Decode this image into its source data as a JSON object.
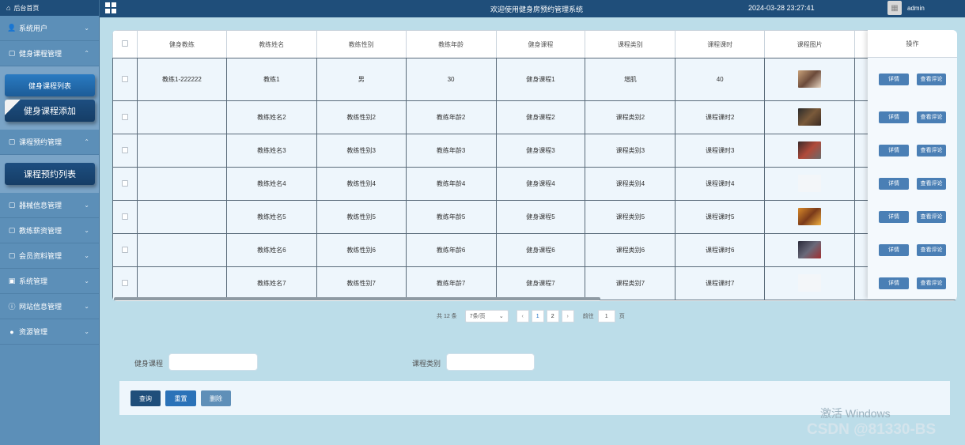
{
  "sidebar": {
    "home_label": "后台首页",
    "items": [
      {
        "label": "系统用户",
        "icon": "user-icon",
        "expanded": false
      },
      {
        "label": "健身课程管理",
        "icon": "doc-icon",
        "expanded": true,
        "children": [
          "健身课程列表",
          "健身课程添加"
        ]
      },
      {
        "label": "课程预约管理",
        "icon": "doc-icon",
        "expanded": true,
        "children": [
          "课程预约列表"
        ]
      },
      {
        "label": "器械信息管理",
        "icon": "doc-icon",
        "expanded": false
      },
      {
        "label": "教练薪资管理",
        "icon": "doc-icon",
        "expanded": false
      },
      {
        "label": "会员资料管理",
        "icon": "doc-icon",
        "expanded": false
      },
      {
        "label": "系统管理",
        "icon": "settings-icon",
        "expanded": false
      },
      {
        "label": "网站信息管理",
        "icon": "info-icon",
        "expanded": false
      },
      {
        "label": "资源管理",
        "icon": "location-icon",
        "expanded": false
      }
    ]
  },
  "header": {
    "title": "欢迎使用健身房预约管理系统",
    "datetime": "2024-03-28 23:27:41",
    "user": "admin"
  },
  "table": {
    "columns": [
      "健身教练",
      "教练姓名",
      "教练性别",
      "教练年龄",
      "健身课程",
      "课程类别",
      "课程课时",
      "课程图片"
    ],
    "op_header": "操作",
    "op_detail": "详情",
    "op_comment": "查看评论",
    "rows": [
      {
        "coach": "教练1-222222",
        "name": "教练1",
        "gender": "男",
        "age": "30",
        "course": "健身课程1",
        "category": "增肌",
        "hours": "40",
        "image": "photo-1"
      },
      {
        "coach": "",
        "name": "教练姓名2",
        "gender": "教练性别2",
        "age": "教练年龄2",
        "course": "健身课程2",
        "category": "课程类别2",
        "hours": "课程课时2",
        "image": "photo-2"
      },
      {
        "coach": "",
        "name": "教练姓名3",
        "gender": "教练性别3",
        "age": "教练年龄3",
        "course": "健身课程3",
        "category": "课程类别3",
        "hours": "课程课时3",
        "image": "photo-3"
      },
      {
        "coach": "",
        "name": "教练姓名4",
        "gender": "教练性别4",
        "age": "教练年龄4",
        "course": "健身课程4",
        "category": "课程类别4",
        "hours": "课程课时4",
        "image": "blank"
      },
      {
        "coach": "",
        "name": "教练姓名5",
        "gender": "教练性别5",
        "age": "教练年龄5",
        "course": "健身课程5",
        "category": "课程类别5",
        "hours": "课程课时5",
        "image": "photo-5"
      },
      {
        "coach": "",
        "name": "教练姓名6",
        "gender": "教练性别6",
        "age": "教练年龄6",
        "course": "健身课程6",
        "category": "课程类别6",
        "hours": "课程课时6",
        "image": "photo-6"
      },
      {
        "coach": "",
        "name": "教练姓名7",
        "gender": "教练性别7",
        "age": "教练年龄7",
        "course": "健身课程7",
        "category": "课程类别7",
        "hours": "课程课时7",
        "image": "blank"
      }
    ]
  },
  "pagination": {
    "total": "共 12 条",
    "page_size": "7条/页",
    "pages": [
      "1",
      "2"
    ],
    "current": "1",
    "goto_label": "前往",
    "goto_value": "1",
    "page_unit": "页"
  },
  "search": {
    "course_label": "健身课程",
    "course_value": "",
    "category_label": "课程类别",
    "category_value": ""
  },
  "actions": {
    "query": "查询",
    "reset": "重置",
    "delete": "删除"
  },
  "watermark": {
    "activate": "激活 Windows",
    "csdn": "CSDN @81330-BS"
  },
  "colors": {
    "sidebar": "#5c8fb8",
    "topbar": "#1f4e7a",
    "accent": "#4a7fb5",
    "background": "#bcdde9"
  }
}
